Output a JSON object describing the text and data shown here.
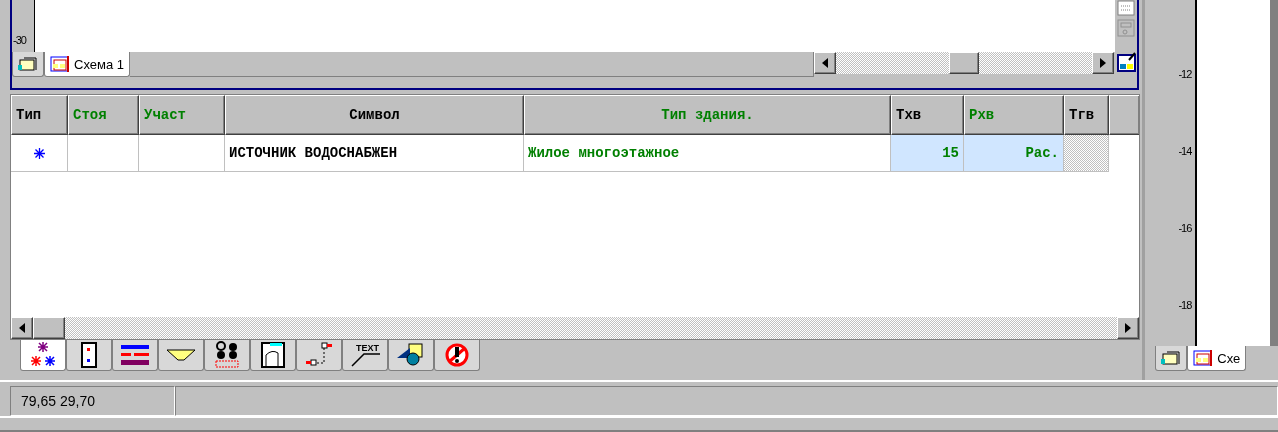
{
  "top_ruler": {
    "label": "-30"
  },
  "schema_tabs": [
    {
      "kind": "layers",
      "selected": false
    },
    {
      "kind": "schema",
      "label": "Схема 1",
      "selected": true
    }
  ],
  "table": {
    "columns": [
      {
        "label": "Тип",
        "color": "#000000"
      },
      {
        "label": "Стоя",
        "color": "#008000"
      },
      {
        "label": "Участ",
        "color": "#008000"
      },
      {
        "label": "Символ",
        "color": "#000000"
      },
      {
        "label": "Тип здания.",
        "color": "#008000"
      },
      {
        "label": "Txв",
        "color": "#000000"
      },
      {
        "label": "Рхв",
        "color": "#008000"
      },
      {
        "label": "Тгв",
        "color": "#000000"
      }
    ],
    "rows": [
      {
        "cells": [
          {
            "kind": "symbol",
            "color": "#0000ff"
          },
          {
            "kind": "plain"
          },
          {
            "kind": "plain"
          },
          {
            "kind": "plain",
            "text": "ИСТОЧНИК ВОДОСНАБЖЕН",
            "color": "#000000"
          },
          {
            "kind": "plain",
            "text": "Жилое многоэтажное",
            "color": "#008000"
          },
          {
            "kind": "edit",
            "text": "15",
            "color": "#008000"
          },
          {
            "kind": "edit",
            "text": "Рас.",
            "color": "#008000"
          },
          {
            "kind": "blank"
          }
        ]
      }
    ]
  },
  "tool_tabs": [
    {
      "kind": "burst",
      "selected": true
    },
    {
      "kind": "dots",
      "selected": false
    },
    {
      "kind": "bars",
      "selected": false
    },
    {
      "kind": "funnel",
      "selected": false
    },
    {
      "kind": "pump",
      "selected": false
    },
    {
      "kind": "panel",
      "selected": false
    },
    {
      "kind": "connector",
      "selected": false
    },
    {
      "kind": "text-label",
      "label": "TEXT",
      "selected": false
    },
    {
      "kind": "shapes",
      "selected": false
    },
    {
      "kind": "forbidden",
      "selected": false
    }
  ],
  "side_ruler": {
    "labels": [
      "-12",
      "-14",
      "-16",
      "-18"
    ]
  },
  "side_tabs": [
    {
      "kind": "layers",
      "selected": false
    },
    {
      "kind": "schema",
      "label": "Схе",
      "selected": true
    }
  ],
  "status_bar": {
    "coordinates": "79,65  29,70"
  }
}
